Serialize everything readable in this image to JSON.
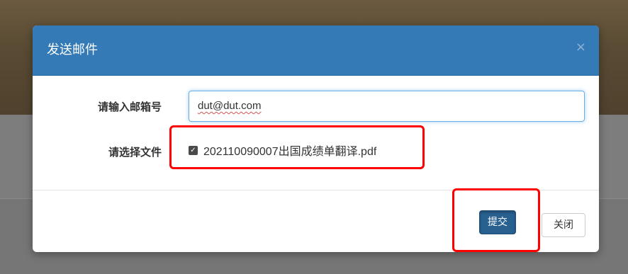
{
  "modal": {
    "title": "发送邮件",
    "close_glyph": "×"
  },
  "form": {
    "email_label": "请输入邮箱号",
    "email_value": "dut@dut.com",
    "file_label": "请选择文件",
    "file_checked": true,
    "file_name": "202110090007出国成绩单翻译.pdf"
  },
  "buttons": {
    "submit_label": "提交",
    "close_label": "关闭"
  },
  "colors": {
    "header": "#337ab7",
    "primary_button": "#286090",
    "annotation": "#ff0000"
  },
  "icons": {
    "close": "close-icon",
    "checkbox": "checkbox-checked-icon"
  }
}
